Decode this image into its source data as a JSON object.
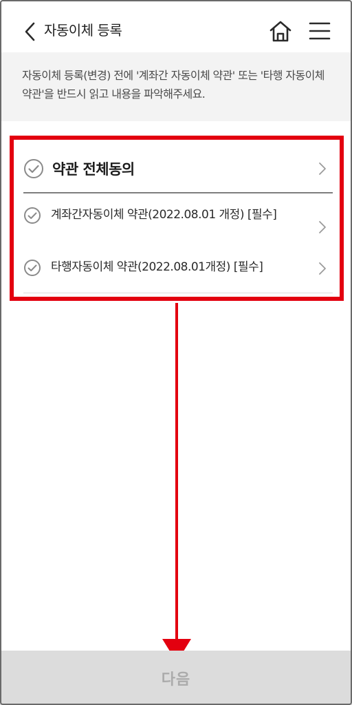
{
  "header": {
    "title": "자동이체 등록",
    "back_icon": "chevron-left-icon",
    "home_icon": "home-icon",
    "menu_icon": "hamburger-menu-icon"
  },
  "notice": {
    "text": "자동이체 등록(변경) 전에 '계좌간 자동이체 약관' 또는 '타행 자동이체 약관'을 반드시 읽고 내용을 파악해주세요."
  },
  "terms": {
    "all_label": "약관 전체동의",
    "items": [
      {
        "label": "계좌간자동이체 약관(2022.08.01 개정) [필수]"
      },
      {
        "label": "타행자동이체 약관(2022.08.01개정) [필수]"
      }
    ]
  },
  "footer": {
    "next_label": "다음"
  },
  "colors": {
    "highlight": "#e3000f",
    "notice_bg": "#f3f3f3",
    "footer_bg": "#dcdcdc",
    "footer_text": "#ababab"
  }
}
